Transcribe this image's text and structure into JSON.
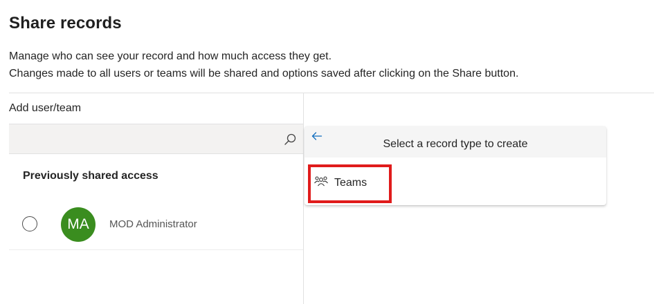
{
  "header": {
    "title": "Share records",
    "description_line1": "Manage who can see your record and how much access they get.",
    "description_line2": "Changes made to all users or teams will be shared and options saved after clicking on the Share button."
  },
  "left_panel": {
    "add_label": "Add user/team",
    "search": {
      "value": "",
      "placeholder": "",
      "icon": "search-icon"
    },
    "previously_shared_label": "Previously shared access",
    "shared_users": [
      {
        "initials": "MA",
        "name": "MOD Administrator",
        "avatar_color": "#3a8d1f",
        "selected": false
      }
    ]
  },
  "dropdown": {
    "back_icon": "arrow-left-icon",
    "title": "Select a record type to create",
    "items": [
      {
        "label": "Teams",
        "icon": "people-team-icon"
      }
    ]
  },
  "colors": {
    "highlight_border": "#e01b1b",
    "accent_blue": "#0f6cbd",
    "avatar_green": "#3a8d1f"
  }
}
